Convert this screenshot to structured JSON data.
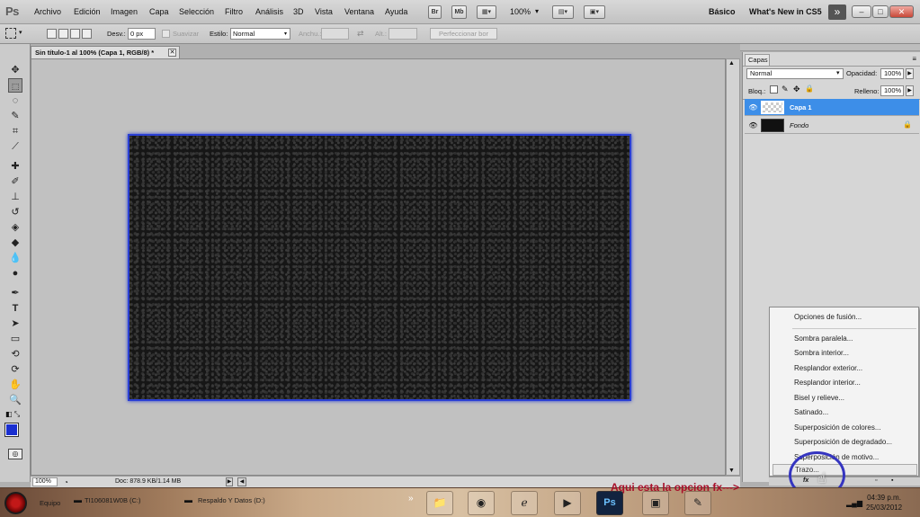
{
  "app": {
    "logo": "Ps",
    "menu": [
      "Archivo",
      "Edición",
      "Imagen",
      "Capa",
      "Selección",
      "Filtro",
      "Análisis",
      "3D",
      "Vista",
      "Ventana",
      "Ayuda"
    ],
    "bridge_icon": "Br",
    "minibridge_icon": "Mb",
    "zoom": "100%",
    "workspace": "Básico",
    "whats_new": "What's New in CS5",
    "more_workspaces": "»",
    "window_buttons": [
      "–",
      "□",
      "✕"
    ]
  },
  "options_bar": {
    "feather_label": "Desv.:",
    "feather_value": "0 px",
    "antialias_label": "Suavizar",
    "style_label": "Estilo:",
    "style_value": "Normal",
    "width_label": "Anchu.:",
    "height_label": "Alt.:",
    "refine_edge": "Perfeccionar bor"
  },
  "document": {
    "tab_title": "Sin título-1 al 100% (Capa 1, RGB/8) *",
    "close": "✕",
    "status_zoom": "100%",
    "status_doc": "Doc: 878.9 KB/1.14 MB"
  },
  "layers_panel": {
    "tab": "Capas",
    "menu_icon": "≡",
    "blend_mode": "Normal",
    "opacity_label": "Opacidad:",
    "opacity_value": "100%",
    "lock_label": "Bloq.:",
    "fill_label": "Relleno:",
    "fill_value": "100%",
    "layers": [
      {
        "name": "Capa 1",
        "selected": true
      },
      {
        "name": "Fondo",
        "selected": false
      }
    ]
  },
  "fx_menu": {
    "items": [
      "Opciones de fusión...",
      "Sombra paralela...",
      "Sombra interior...",
      "Resplandor exterior...",
      "Resplandor interior...",
      "Bisel y relieve...",
      "Satinado...",
      "Superposición de colores...",
      "Superposición de degradado...",
      "Superposición de motivo...",
      "Trazo..."
    ]
  },
  "annotation": {
    "text": "Aqui esta la opcion fx--->"
  },
  "taskbar": {
    "equipo": "Equipo",
    "drive1": "TI106081W0B (C:)",
    "drive2": "Respaldo Y Datos (D:)",
    "ps_label": "Ps",
    "time": "04:39 p.m.",
    "date": "25/03/2012"
  },
  "colors": {
    "canvas_border": "#2a3fd2",
    "selection": "#3d8ee8",
    "annotation_text": "#a8102a",
    "annotation_circle": "#3535c0"
  }
}
